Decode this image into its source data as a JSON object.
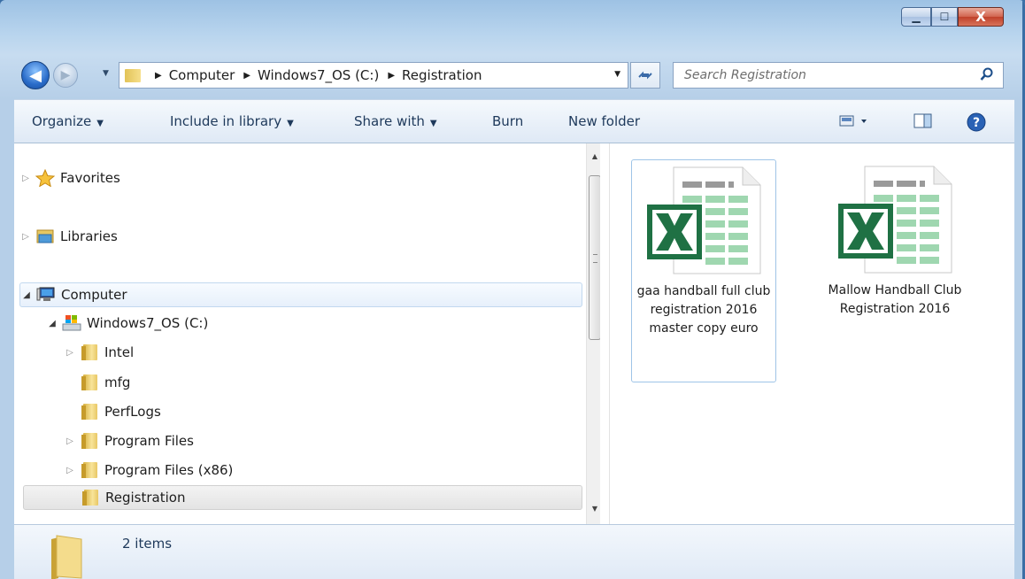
{
  "window": {
    "caption_buttons": {
      "minimize_glyph": "▁",
      "maximize_glyph": "☐",
      "close_glyph": "X"
    }
  },
  "navigation": {
    "back_glyph": "◀",
    "forward_glyph": "▶",
    "breadcrumbs": [
      "Computer",
      "Windows7_OS (C:)",
      "Registration"
    ],
    "search_placeholder": "Search Registration"
  },
  "toolbar": {
    "organize": "Organize",
    "include_in_library": "Include in library",
    "share_with": "Share with",
    "burn": "Burn",
    "new_folder": "New folder"
  },
  "tree": {
    "favorites": "Favorites",
    "libraries": "Libraries",
    "computer": "Computer",
    "drive": "Windows7_OS (C:)",
    "folders": [
      "Intel",
      "mfg",
      "PerfLogs",
      "Program Files",
      "Program Files (x86)",
      "Registration"
    ]
  },
  "files": [
    {
      "name": "gaa handball full club registration 2016 master copy euro",
      "icon": "excel-file-icon"
    },
    {
      "name": "Mallow Handball Club Registration 2016",
      "icon": "excel-file-icon"
    }
  ],
  "status": {
    "item_count": "2 items"
  },
  "colors": {
    "excel_green": "#1f7144",
    "title_blue": "#9ec2e4",
    "link_text": "#1e395b"
  }
}
